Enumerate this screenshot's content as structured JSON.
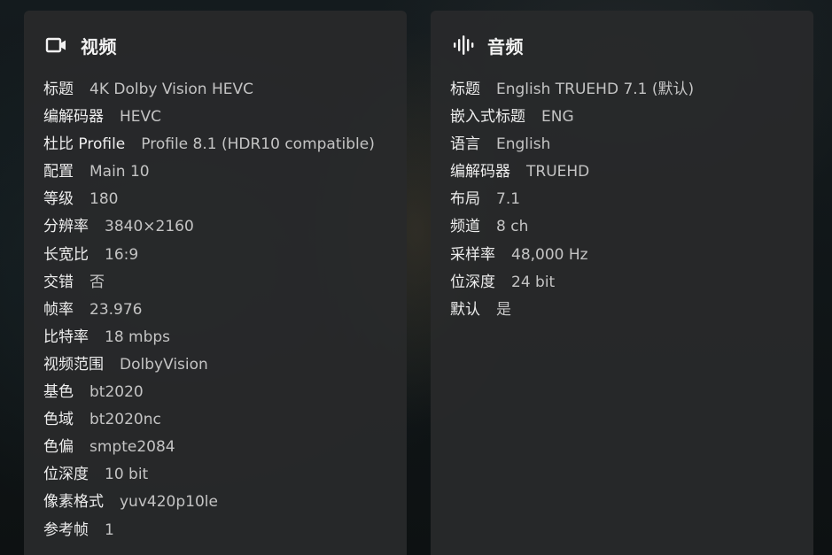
{
  "video": {
    "title": "视频",
    "icon": "video-camera-icon",
    "rows": [
      {
        "label": "标题",
        "value": "4K Dolby Vision HEVC"
      },
      {
        "label": "编解码器",
        "value": "HEVC"
      },
      {
        "label": "杜比 Profile",
        "value": "Profile 8.1 (HDR10 compatible)"
      },
      {
        "label": "配置",
        "value": "Main 10"
      },
      {
        "label": "等级",
        "value": "180"
      },
      {
        "label": "分辨率",
        "value": "3840×2160"
      },
      {
        "label": "长宽比",
        "value": "16:9"
      },
      {
        "label": "交错",
        "value": "否"
      },
      {
        "label": "帧率",
        "value": "23.976"
      },
      {
        "label": "比特率",
        "value": "18 mbps"
      },
      {
        "label": "视频范围",
        "value": "DolbyVision"
      },
      {
        "label": "基色",
        "value": "bt2020"
      },
      {
        "label": "色域",
        "value": "bt2020nc"
      },
      {
        "label": "色偏",
        "value": "smpte2084"
      },
      {
        "label": "位深度",
        "value": "10 bit"
      },
      {
        "label": "像素格式",
        "value": "yuv420p10le"
      },
      {
        "label": "参考帧",
        "value": "1"
      }
    ]
  },
  "audio": {
    "title": "音频",
    "icon": "audio-waveform-icon",
    "rows": [
      {
        "label": "标题",
        "value": "English TRUEHD 7.1 (默认)"
      },
      {
        "label": "嵌入式标题",
        "value": "ENG"
      },
      {
        "label": "语言",
        "value": "English"
      },
      {
        "label": "编解码器",
        "value": "TRUEHD"
      },
      {
        "label": "布局",
        "value": "7.1"
      },
      {
        "label": "频道",
        "value": "8 ch"
      },
      {
        "label": "采样率",
        "value": "48,000 Hz"
      },
      {
        "label": "位深度",
        "value": "24 bit"
      },
      {
        "label": "默认",
        "value": "是"
      }
    ]
  }
}
